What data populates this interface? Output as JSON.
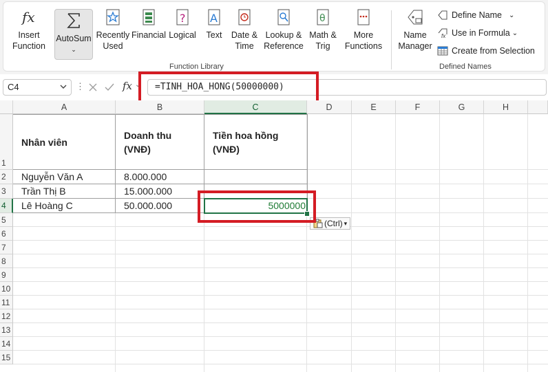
{
  "ribbon": {
    "insert_function": "Insert\nFunction",
    "autosum": "AutoSum",
    "recently_used": "Recently\nUsed",
    "financial": "Financial",
    "logical": "Logical",
    "text": "Text",
    "date_time": "Date &\nTime",
    "lookup_reference": "Lookup &\nReference",
    "math_trig": "Math &\nTrig",
    "more_functions": "More\nFunctions",
    "function_library_label": "Function Library",
    "name_manager": "Name\nManager",
    "define_name": "Define Name",
    "use_in_formula": "Use in Formula",
    "create_from_selection": "Create from Selection",
    "defined_names_label": "Defined Names"
  },
  "formula_bar": {
    "name_box": "C4",
    "fx": "fx",
    "formula": "=TINH_HOA_HONG(50000000)"
  },
  "sheet": {
    "columns": [
      "A",
      "B",
      "C",
      "D",
      "E",
      "F",
      "G",
      "H"
    ],
    "rows": [
      "1",
      "2",
      "3",
      "4",
      "5",
      "6",
      "7",
      "8",
      "9",
      "10",
      "11",
      "12",
      "13",
      "14",
      "15"
    ],
    "header_a": "Nhân viên",
    "header_b": "Doanh thu\n(VNĐ)",
    "header_c": "Tiền hoa hồng\n(VNĐ)",
    "data": [
      {
        "name": "Nguyễn Văn A",
        "revenue": "8.000.000",
        "commission": ""
      },
      {
        "name": "Trần Thị B",
        "revenue": "15.000.000",
        "commission": ""
      },
      {
        "name": "Lê Hoàng C",
        "revenue": "50.000.000",
        "commission": "5000000"
      }
    ],
    "paste_options": "(Ctrl)"
  },
  "colors": {
    "accent": "#217346",
    "highlight_red": "#d41c24",
    "result_text": "#1e7b34"
  }
}
